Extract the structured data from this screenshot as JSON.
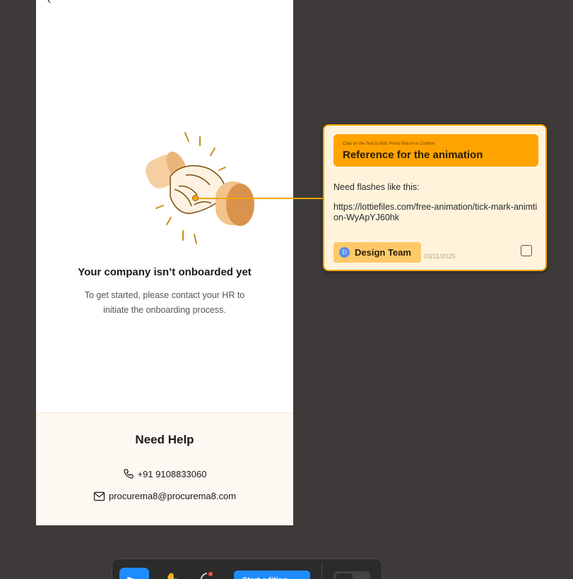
{
  "screen": {
    "back_glyph": "‹",
    "title": "Your company isn’t onboarded yet",
    "description": "To get started, please contact your HR to initiate the onboarding process."
  },
  "help": {
    "title": "Need Help",
    "phone": "+91 9108833060",
    "email": "procurema8@procurema8.com"
  },
  "note": {
    "hint": "Click on the Text to Edit. Press Return to Confirm",
    "heading": "Reference for the animation",
    "body_line1": "Need flashes like this:",
    "body_link": "https://lottiefiles.com/free-animation/tick-mark-animtion-WyApYJ60hk",
    "tag_avatar": "D",
    "tag_label": "Design Team",
    "date": "03/11/2025"
  },
  "toolbar": {
    "primary_label": "Start editing"
  },
  "colors": {
    "canvas_bg": "#3d3a39",
    "accent_orange": "#ffa300",
    "note_bg": "#fff3dc",
    "tool_blue": "#1e8cff"
  },
  "icons": {
    "illustration": "handshake-illustration",
    "phone": "phone-icon",
    "mail": "mail-icon",
    "move_tool": "move-tool-icon",
    "hand_tool": "hand-tool-icon",
    "comment_tool": "comment-tool-icon"
  }
}
